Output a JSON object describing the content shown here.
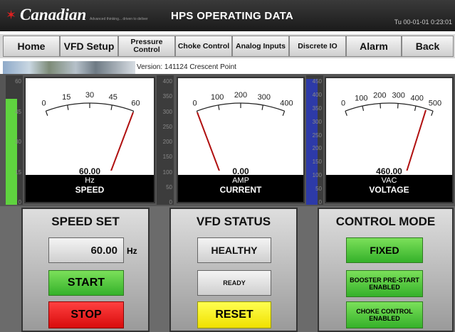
{
  "header": {
    "logo_text": "Canadian",
    "logo_tagline": "Advanced thinking... driven to deliver",
    "title": "HPS OPERATING DATA",
    "clock": "Tu 00-01-01  0:23:01"
  },
  "nav": [
    {
      "label": "Home"
    },
    {
      "label": "VFD Setup"
    },
    {
      "label": "Pressure Control"
    },
    {
      "label": "Choke Control"
    },
    {
      "label": "Analog Inputs"
    },
    {
      "label": "Discrete IO"
    },
    {
      "label": "Alarm"
    },
    {
      "label": "Back"
    }
  ],
  "version": "Version: 141124 Crescent Point",
  "gauges": [
    {
      "name": "SPEED",
      "unit": "Hz",
      "value": "60.00",
      "dial_ticks": [
        "0",
        "15",
        "30",
        "45",
        "60"
      ],
      "dial_max": 60,
      "reading": 60,
      "bar_ticks": [
        "60",
        "45",
        "30",
        "15",
        "0"
      ],
      "bar_fraction": 0.82,
      "bar_color": "#5fd33f"
    },
    {
      "name": "CURRENT",
      "unit": "AMP",
      "value": "0.00",
      "dial_ticks": [
        "0",
        "100",
        "200",
        "300",
        "400"
      ],
      "dial_max": 400,
      "reading": 0,
      "bar_ticks": [
        "400",
        "350",
        "300",
        "250",
        "200",
        "150",
        "100",
        "50",
        "0"
      ],
      "bar_fraction": 0,
      "bar_color": "#5fd33f"
    },
    {
      "name": "VOLTAGE",
      "unit": "VAC",
      "value": "460.00",
      "dial_ticks": [
        "0",
        "100",
        "200",
        "300",
        "400",
        "500"
      ],
      "dial_max": 500,
      "reading": 460,
      "bar_ticks": [
        "450",
        "400",
        "350",
        "300",
        "250",
        "200",
        "150",
        "100",
        "50",
        "0"
      ],
      "bar_fraction": 0.97,
      "bar_color": "#2d3aa8"
    }
  ],
  "speed_set": {
    "title": "SPEED SET",
    "value": "60.00",
    "unit": "Hz",
    "start_label": "START",
    "stop_label": "STOP"
  },
  "vfd_status": {
    "title": "VFD STATUS",
    "health": "HEALTHY",
    "state": "READY",
    "reset_label": "RESET"
  },
  "control_mode": {
    "title": "CONTROL MODE",
    "mode": "FIXED",
    "booster": "BOOSTER PRE-START ENABLED",
    "choke": "CHOKE CONTROL ENABLED"
  },
  "colors": {
    "header_bg": "#1a1a1a",
    "green": "#35b12a",
    "red": "#d80c0c",
    "yellow": "#f0e000",
    "voltage_bar": "#2d3aa8",
    "speed_bar": "#5fd33f",
    "needle": "#b01010"
  },
  "icons": {
    "logo": "maple-leaf-icon"
  }
}
